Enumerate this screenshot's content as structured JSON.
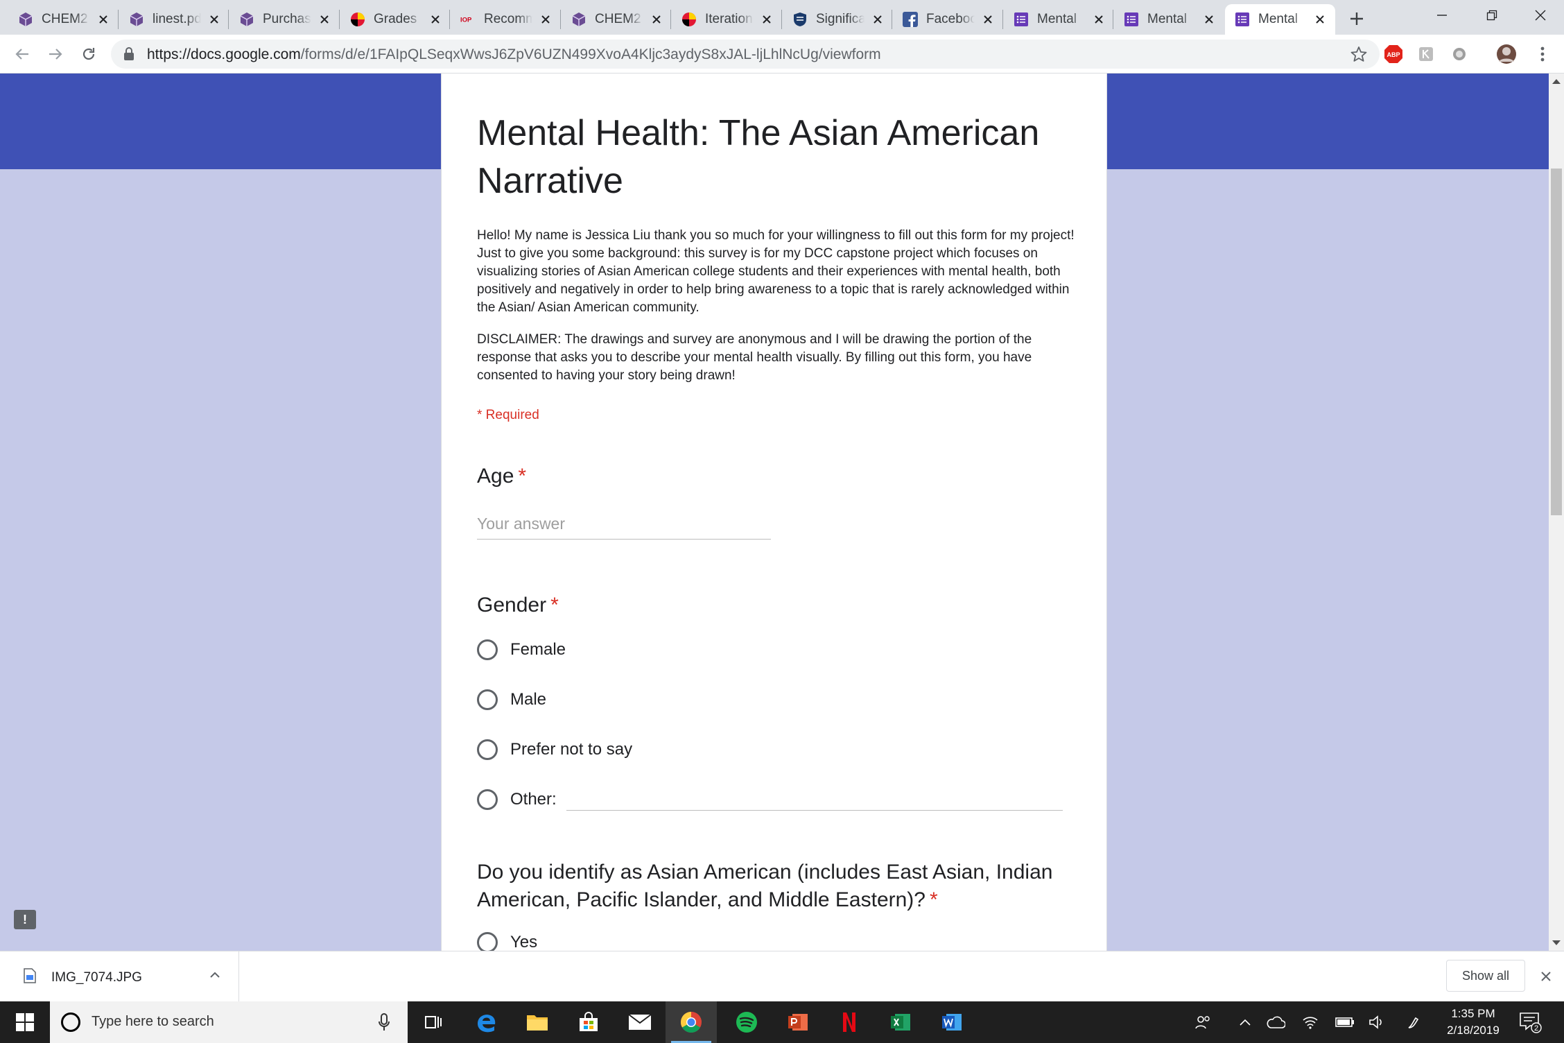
{
  "browser": {
    "tabs": [
      {
        "title": "CHEM2",
        "icon": "purple-cube-icon"
      },
      {
        "title": "linest.pdf",
        "icon": "purple-cube-icon"
      },
      {
        "title": "Purchase",
        "icon": "purple-cube-icon"
      },
      {
        "title": "Grades",
        "icon": "umd-shield-icon"
      },
      {
        "title": "Recommend",
        "icon": "iop-icon"
      },
      {
        "title": "CHEM2",
        "icon": "purple-cube-icon"
      },
      {
        "title": "Iteration",
        "icon": "umd-shield-icon"
      },
      {
        "title": "Significance",
        "icon": "shield-icon"
      },
      {
        "title": "Facebook",
        "icon": "facebook-icon"
      },
      {
        "title": "Mental",
        "icon": "google-forms-icon"
      },
      {
        "title": "Mental",
        "icon": "google-forms-icon"
      },
      {
        "title": "Mental",
        "icon": "google-forms-icon"
      }
    ],
    "url_host": "https://docs.google.com",
    "url_path": "/forms/d/e/1FAIpQLSeqxWwsJ6ZpV6UZN499XvoA4Kljc3aydyS8xJAL-ljLhlNcUg/viewform",
    "ext_abp_label": "ABP"
  },
  "form": {
    "title": "Mental Health: The Asian American Narrative",
    "description_1": "Hello! My name is Jessica Liu thank you so much for your willingness to fill out this form for my project! Just to give you some background: this survey is for my DCC capstone project which focuses on visualizing stories of Asian American college students and their experiences with mental health, both positively and negatively in order to help bring awareness to a topic that is rarely acknowledged within the Asian/ Asian American community.",
    "description_2": "DISCLAIMER: The drawings and survey are anonymous and I will be drawing the portion of the response that asks you to describe your mental health visually. By filling out this form, you have consented to having your story being drawn!",
    "required_note": "* Required",
    "required_star": "*",
    "age": {
      "label": "Age",
      "placeholder": "Your answer"
    },
    "gender": {
      "label": "Gender",
      "options": [
        "Female",
        "Male",
        "Prefer not to say",
        "Other:"
      ]
    },
    "asian": {
      "label": "Do you identify as Asian American (includes East Asian, Indian American, Pacific Islander, and Middle Eastern)?",
      "options": [
        "Yes"
      ]
    },
    "feedback_glyph": "!"
  },
  "downloads": {
    "file_name": "IMG_7074.JPG",
    "show_all": "Show all"
  },
  "taskbar": {
    "search_placeholder": "Type here to search",
    "time": "1:35 PM",
    "date": "2/18/2019",
    "notification_count": "2"
  }
}
